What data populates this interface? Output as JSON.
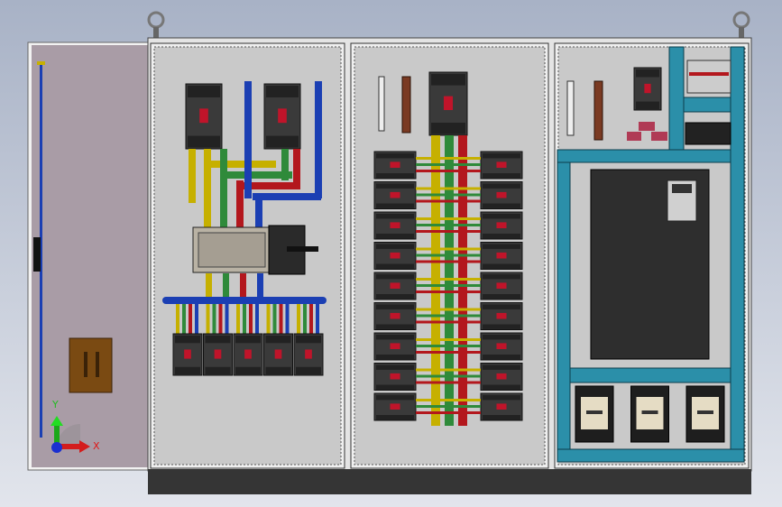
{
  "viewport": {
    "triad": {
      "x_label": "X",
      "y_label": "Y"
    }
  },
  "colors": {
    "door": "#a99ca6",
    "panel": "#c9c9c9",
    "duct": "#2b8fa9",
    "bus_yellow": "#c6b000",
    "bus_green": "#2f8a3a",
    "bus_red": "#b3171d",
    "bus_blue": "#1b3fb3",
    "breaker": "#3a3a3a",
    "base": "#353535"
  },
  "panel2": {
    "breaker_rows": 9
  },
  "panel1": {
    "branch_breakers": 5
  },
  "panel3": {
    "contactors": 3
  }
}
